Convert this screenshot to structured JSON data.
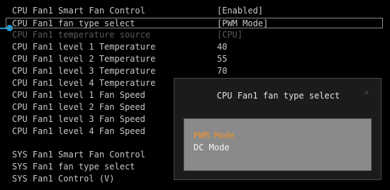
{
  "settings": [
    {
      "label": "CPU Fan1 Smart Fan Control",
      "value": "[Enabled]"
    },
    {
      "label": "CPU Fan1 fan type select",
      "value": "[PWM Mode]"
    },
    {
      "label": "CPU Fan1 temperature source",
      "value": "[CPU]"
    },
    {
      "label": "CPU Fan1 level 1 Temperature",
      "value": "40"
    },
    {
      "label": "CPU Fan1 level 2 Temperature",
      "value": "55"
    },
    {
      "label": "CPU Fan1 level 3 Temperature",
      "value": "70"
    },
    {
      "label": "CPU Fan1 level 4 Temperature",
      "value": ""
    },
    {
      "label": "CPU Fan1 level 1 Fan Speed",
      "value": ""
    },
    {
      "label": "CPU Fan1 level 2 Fan Speed",
      "value": ""
    },
    {
      "label": "CPU Fan1 level 3 Fan Speed",
      "value": ""
    },
    {
      "label": "CPU Fan1 level 4 Fan Speed",
      "value": ""
    },
    {
      "label": "SYS Fan1 Smart Fan Control",
      "value": ""
    },
    {
      "label": "SYS Fan1 fan type select",
      "value": ""
    },
    {
      "label": "SYS Fan1 Control (V)",
      "value": ""
    }
  ],
  "dialog": {
    "title": "CPU Fan1 fan type select",
    "close_icon": "×",
    "options": [
      "PWM Mode",
      "DC Mode"
    ]
  },
  "colors": {
    "background": "#000000",
    "text": "#c8c8c8",
    "disabled_text": "#5a5a5a",
    "cursor": "#1e9cd6",
    "highlighted_option": "#f0922e"
  }
}
